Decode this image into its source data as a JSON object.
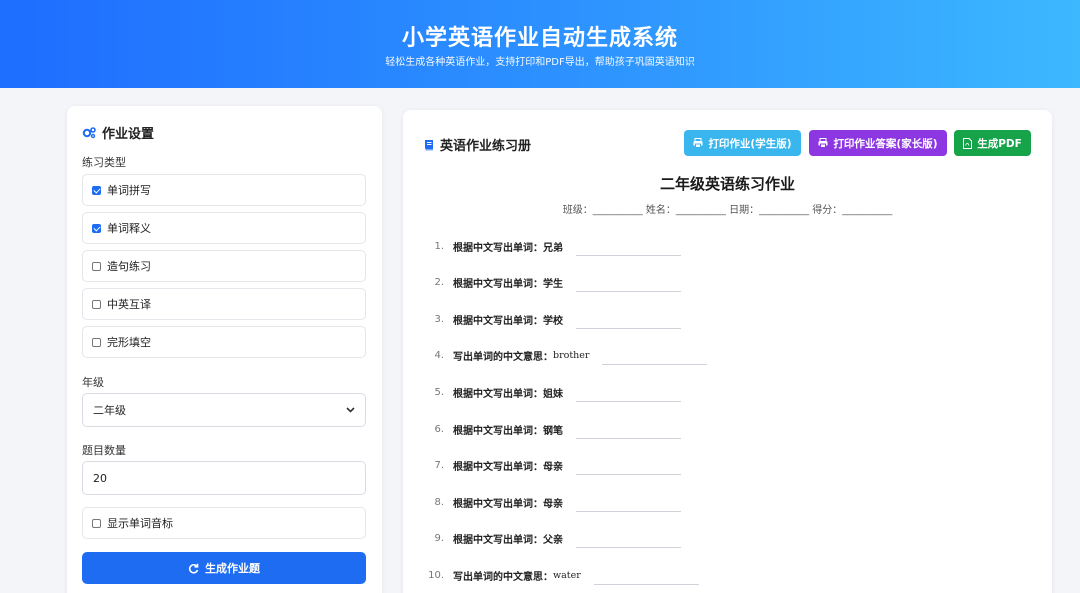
{
  "header": {
    "title": "小学英语作业自动生成系统",
    "subtitle": "轻松生成各种英语作业，支持打印和PDF导出，帮助孩子巩固英语知识"
  },
  "settings": {
    "title": "作业设置",
    "type_label": "练习类型",
    "types": [
      {
        "label": "单词拼写",
        "checked": true
      },
      {
        "label": "单词释义",
        "checked": true
      },
      {
        "label": "造句练习",
        "checked": false
      },
      {
        "label": "中英互译",
        "checked": false
      },
      {
        "label": "完形填空",
        "checked": false
      }
    ],
    "grade_label": "年级",
    "grade_value": "二年级",
    "count_label": "题目数量",
    "count_value": "20",
    "phonetic_label": "显示单词音标",
    "phonetic_checked": false,
    "generate_label": "生成作业题"
  },
  "workbook": {
    "title": "英语作业练习册",
    "print_student": "打印作业(学生版)",
    "print_answers": "打印作业答案(家长版)",
    "pdf": "生成PDF",
    "sheet_title": "二年级英语练习作业",
    "meta": "班级：__________ 姓名：__________ 日期：__________ 得分：__________",
    "questions": [
      {
        "n": "1.",
        "prompt": "根据中文写出单词：",
        "word": "兄弟"
      },
      {
        "n": "2.",
        "prompt": "根据中文写出单词：",
        "word": "学生"
      },
      {
        "n": "3.",
        "prompt": "根据中文写出单词：",
        "word": "学校"
      },
      {
        "n": "4.",
        "prompt": "写出单词的中文意思：",
        "word": "brother"
      },
      {
        "n": "5.",
        "prompt": "根据中文写出单词：",
        "word": "姐妹"
      },
      {
        "n": "6.",
        "prompt": "根据中文写出单词：",
        "word": "钢笔"
      },
      {
        "n": "7.",
        "prompt": "根据中文写出单词：",
        "word": "母亲"
      },
      {
        "n": "8.",
        "prompt": "根据中文写出单词：",
        "word": "母亲"
      },
      {
        "n": "9.",
        "prompt": "根据中文写出单词：",
        "word": "父亲"
      },
      {
        "n": "10.",
        "prompt": "写出单词的中文意思：",
        "word": "water"
      }
    ]
  },
  "colors": {
    "primary": "#1d6cf2",
    "cyan": "#39b6ee",
    "purple": "#8d37e3",
    "green": "#16a34a"
  }
}
